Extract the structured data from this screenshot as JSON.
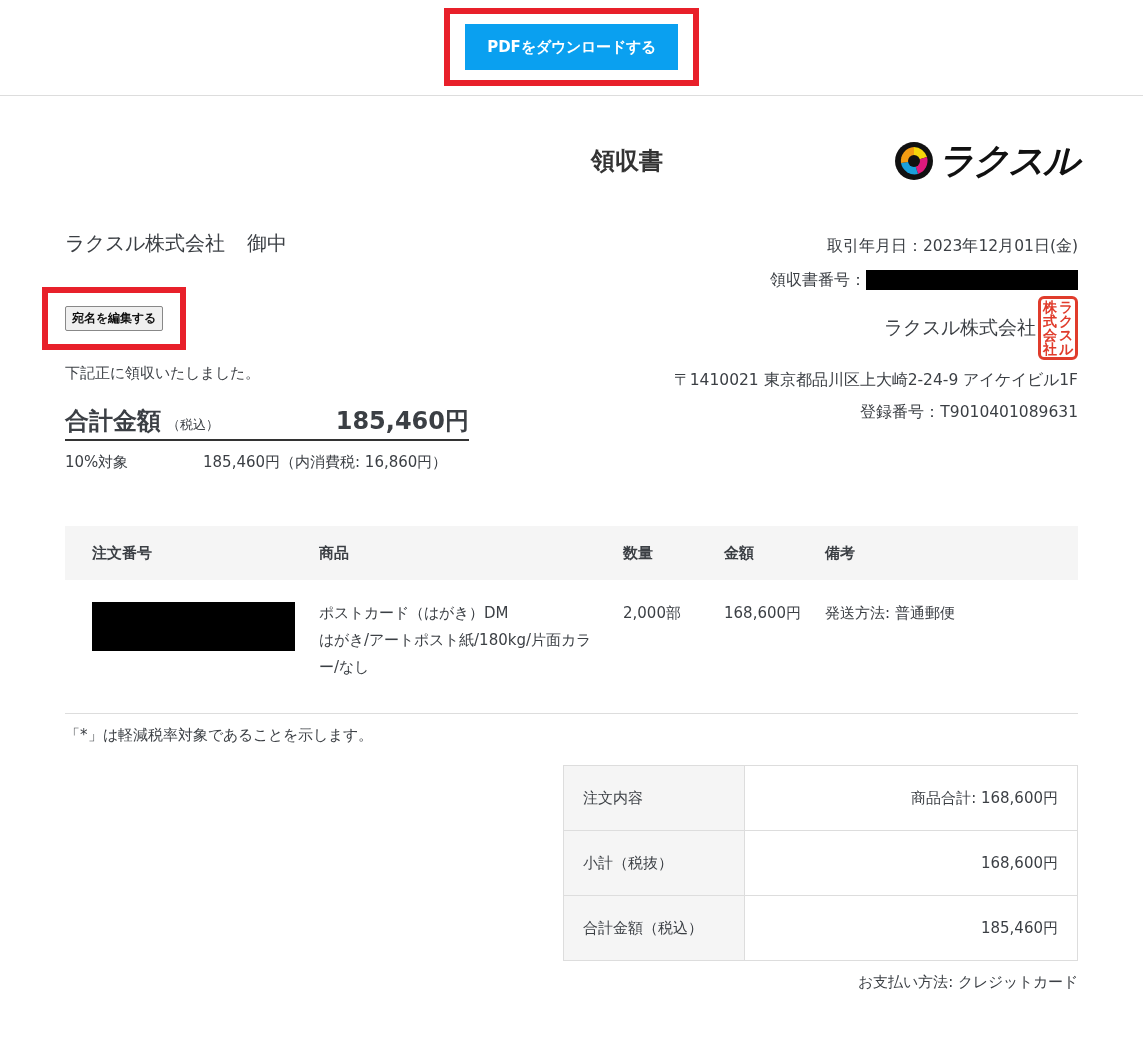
{
  "download_button": {
    "label": "PDFをダウンロードする",
    "highlighted": true
  },
  "title": "領収書",
  "logo": {
    "text": "ラクスル"
  },
  "recipient": {
    "name": "ラクスル株式会社",
    "honorific": "御中"
  },
  "edit_button": {
    "label": "宛名を編集する",
    "highlighted": true
  },
  "received_note": "下記正に領収いたしました。",
  "total": {
    "label": "合計金額",
    "tax_note": "（税込）",
    "amount": "185,460円"
  },
  "tax_breakdown": {
    "rate": "10%対象",
    "detail": "185,460円（内消費税: 16,860円）"
  },
  "issuer": {
    "date": "取引年月日：2023年12月01日(金)",
    "receipt_no_label": "領収書番号：",
    "receipt_no_redacted": true,
    "company": "ラクスル株式会社",
    "stamp": [
      "株式会社",
      "ラクスル"
    ],
    "address": "〒1410021 東京都品川区上大崎2-24-9 アイケイビル1F",
    "registration": "登録番号：T9010401089631"
  },
  "orders": {
    "columns": [
      "注文番号",
      "商品",
      "数量",
      "金額",
      "備考"
    ],
    "rows": [
      {
        "order_no_redacted": true,
        "product": "ポストカード（はがき）DM",
        "spec": "はがき/アートポスト紙/180kg/片面カラー/なし",
        "quantity": "2,000部",
        "amount": "168,600円",
        "note": "発送方法: 普通郵便"
      }
    ]
  },
  "reduced_tax_note": "「*」は軽減税率対象であることを示します。",
  "summary": [
    {
      "label": "注文内容",
      "value": "商品合計: 168,600円"
    },
    {
      "label": "小計（税抜）",
      "value": "168,600円"
    },
    {
      "label": "合計金額（税込）",
      "value": "185,460円"
    }
  ],
  "payment_method": "お支払い方法: クレジットカード"
}
